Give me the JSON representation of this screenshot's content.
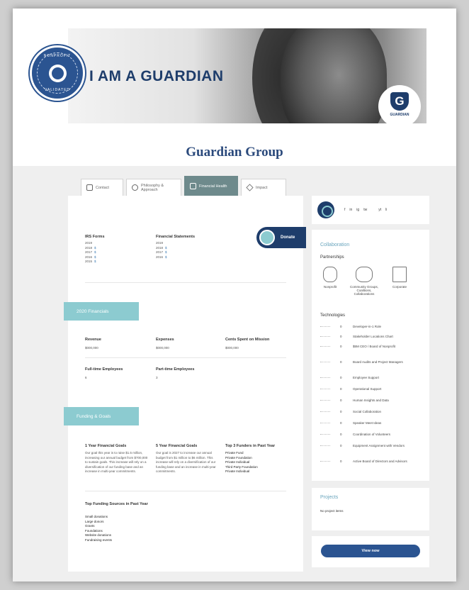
{
  "hero": {
    "title": "I AM A GUARDIAN",
    "badge_top": "NONPROFIT",
    "badge_bottom": "VALIDATED",
    "logo_text": "GUARDIAN"
  },
  "org_name": "Guardian Group",
  "tabs": [
    {
      "label": "Contact",
      "icon": "contact-icon"
    },
    {
      "label": "Philosophy & Approach",
      "icon": "philosophy-icon"
    },
    {
      "label": "Financial Health",
      "icon": "financial-icon",
      "active": true
    },
    {
      "label": "Impact",
      "icon": "impact-icon"
    }
  ],
  "donate_label": "Donate",
  "irs": {
    "label": "IRS Forms",
    "rows": [
      {
        "year": "2019",
        "val": ""
      },
      {
        "year": "2018",
        "val": "$"
      },
      {
        "year": "2017",
        "val": "$"
      },
      {
        "year": "2016",
        "val": "$"
      },
      {
        "year": "2015",
        "val": "$"
      }
    ]
  },
  "statements": {
    "label": "Financial Statements",
    "rows": [
      {
        "year": "2019",
        "val": ""
      },
      {
        "year": "2018",
        "val": "$"
      },
      {
        "year": "2017",
        "val": "$"
      },
      {
        "year": "2016",
        "val": "$"
      }
    ]
  },
  "financials": {
    "tag": "2020 Financials",
    "revenue_label": "Revenue",
    "revenue_value": "$000,000",
    "expenses_label": "Expenses",
    "expenses_value": "$000,000",
    "cents_label": "Cents Spent on Mission",
    "cents_value": "$000,000",
    "fulltime_label": "Full-time Employees",
    "fulltime_value": "6",
    "parttime_label": "Part-time Employees",
    "parttime_value": "3"
  },
  "funding": {
    "tag": "Funding & Goals",
    "goals1_label": "1 Year Financial Goals",
    "goals1_text": "Our goal this year is to raise $1.5 million, increasing our annual budget from $700,000 to sustain goals. This increase will rely on a diversification of our funding base and an increase in multi-year commitments.",
    "goals5_label": "5 Year Financial Goals",
    "goals5_text": "Our goal is 2027 to increase our annual budget from $1 million to $6 million. This increase will rely on a diversification of our funding base and an increase in multi-year commitments.",
    "funders_label": "Top 3 Funders in Past Year",
    "funders": [
      "Private Fund",
      "Private Foundation",
      "Private Individual",
      "Third Party Foundation",
      "Private Individual"
    ],
    "sources_label": "Top Funding Sources in Past Year",
    "sources": [
      "Small donations",
      "Large donors",
      "Grants",
      "Foundations",
      "Website donations",
      "Fundraising events"
    ]
  },
  "social_icons": [
    "f",
    "in",
    "ig",
    "tw",
    "yt",
    "li"
  ],
  "collaboration": {
    "title": "Collaboration",
    "partnerships_label": "Partnerships",
    "partners": [
      {
        "label": "Nonprofit",
        "icon": "nonprofit-icon"
      },
      {
        "label": "Community Groups, Coalitions, Collaborations",
        "icon": "community-icon"
      },
      {
        "label": "Corporate",
        "icon": "corporate-icon"
      }
    ],
    "tech_label": "Technologies",
    "tech": [
      {
        "num": "0",
        "label": "Developer-in-1 Role"
      },
      {
        "num": "0",
        "label": "Stakeholder Locations Chart"
      },
      {
        "num": "0",
        "label": "$5M CEO / Board of Nonprofit"
      },
      {
        "num": "0",
        "label": "Board Audits and Project Managers"
      },
      {
        "num": "0",
        "label": "Employee Support"
      },
      {
        "num": "0",
        "label": "Operational Support"
      },
      {
        "num": "0",
        "label": "Human Insights and Data"
      },
      {
        "num": "0",
        "label": "Social Collaboration"
      },
      {
        "num": "0",
        "label": "Speaker Meet Ideas"
      },
      {
        "num": "0",
        "label": "Coordination of Volunteers"
      },
      {
        "num": "0",
        "label": "Equipment Assignment with Vendors"
      },
      {
        "num": "0",
        "label": "Active Board of Directors and Advisors"
      }
    ]
  },
  "projects": {
    "title": "Projects",
    "text": "No project items"
  },
  "view_button": "View now"
}
